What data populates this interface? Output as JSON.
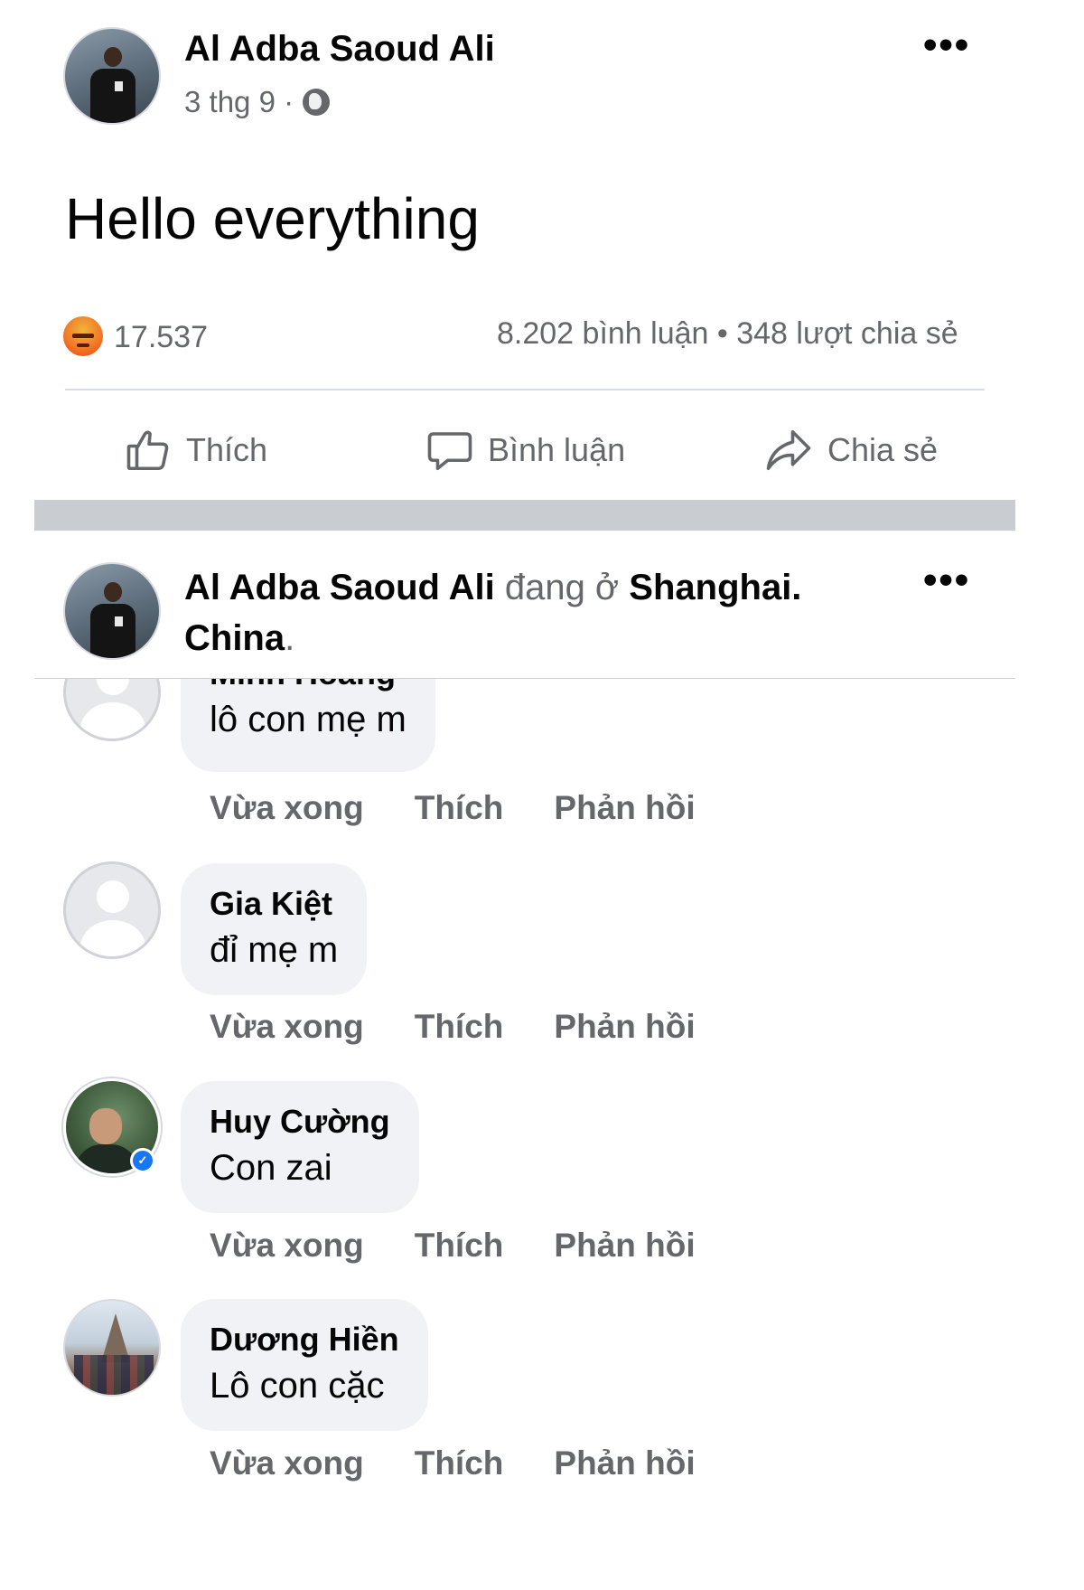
{
  "post": {
    "author": "Al Adba Saoud Ali",
    "date": "3 thg 9 ·",
    "text": "Hello everything",
    "reaction_count": "17.537",
    "stats": "8.202 bình luận • 348 lượt chia sẻ",
    "actions": {
      "like": "Thích",
      "comment": "Bình luận",
      "share": "Chia sẻ"
    },
    "more_icon": "more-dots-icon",
    "privacy_icon": "globe-icon",
    "reaction_icon": "angry-reaction-icon"
  },
  "sticky_header": {
    "author": "Al Adba Saoud Ali",
    "connector": " đang ở ",
    "place1": "Shanghai.",
    "place2": "China",
    "trail": "."
  },
  "comments": [
    {
      "author": "Minh Hoàng",
      "text": "lô con mẹ m",
      "time": "Vừa xong",
      "like": "Thích",
      "reply": "Phản hồi"
    },
    {
      "author": "Gia Kiệt",
      "text": "đỉ mẹ m",
      "time": "Vừa xong",
      "like": "Thích",
      "reply": "Phản hồi"
    },
    {
      "author": "Huy Cường",
      "text": "Con zai",
      "time": "Vừa xong",
      "like": "Thích",
      "reply": "Phản hồi"
    },
    {
      "author": "Dương Hiền",
      "text": "Lô con cặc",
      "time": "Vừa xong",
      "like": "Thích",
      "reply": "Phản hồi"
    }
  ],
  "colors": {
    "text": "#050505",
    "secondary": "#65676b",
    "bubble": "#f0f2f5",
    "divider": "#dadde1",
    "band": "#c9ccd1"
  }
}
